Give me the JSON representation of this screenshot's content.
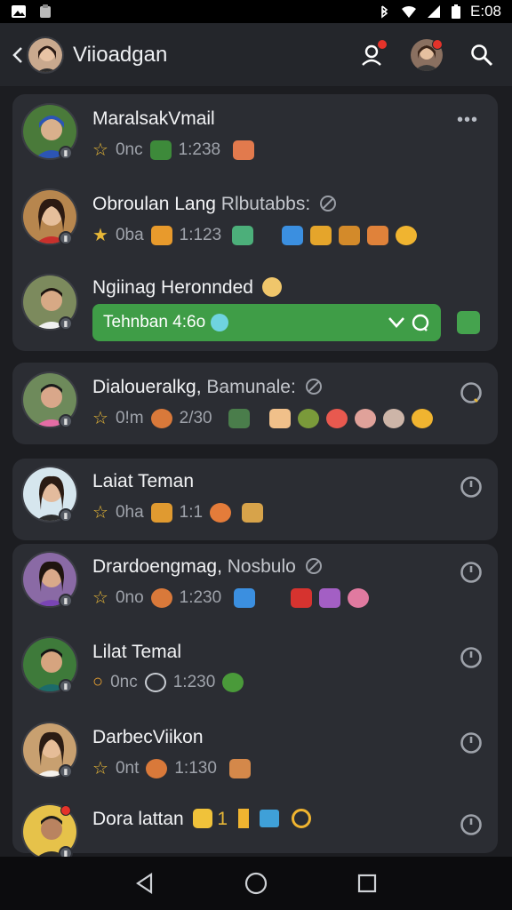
{
  "status": {
    "time": "E:08"
  },
  "header": {
    "title": "Viioadgan"
  },
  "chats": [
    {
      "name": "MaralsakVmail",
      "meta": [
        "0nc",
        "1:238"
      ]
    },
    {
      "name": "Obroulan Lang",
      "sub": "Rlbutabbs:",
      "meta": [
        "0ba",
        "1:123"
      ]
    },
    {
      "name": "Ngiinag Heronnded",
      "bar": "Tehnban 4:6o"
    },
    {
      "name": "Dialoueralkg,",
      "sub": "Bamunale:",
      "meta": [
        "0!m",
        "2/30"
      ]
    },
    {
      "name": "Laiat Teman",
      "meta": [
        "0ha",
        "1:1"
      ]
    },
    {
      "name": "Drardoengmag,",
      "sub": "Nosbulo",
      "meta": [
        "0no",
        "1:230"
      ]
    },
    {
      "name": "Lilat Temal",
      "meta": [
        "0nc",
        "1:230"
      ]
    },
    {
      "name": "DarbecViikon",
      "meta": [
        "0nt",
        "1:130"
      ]
    },
    {
      "name": "Dora lattan",
      "meta": [
        "1"
      ]
    }
  ],
  "icons": {
    "menu": "more-icon",
    "timer": "clock-icon"
  },
  "colors": {
    "accent_green": "#3f9d47",
    "star": "#e7b737",
    "notif": "#e5332a"
  }
}
